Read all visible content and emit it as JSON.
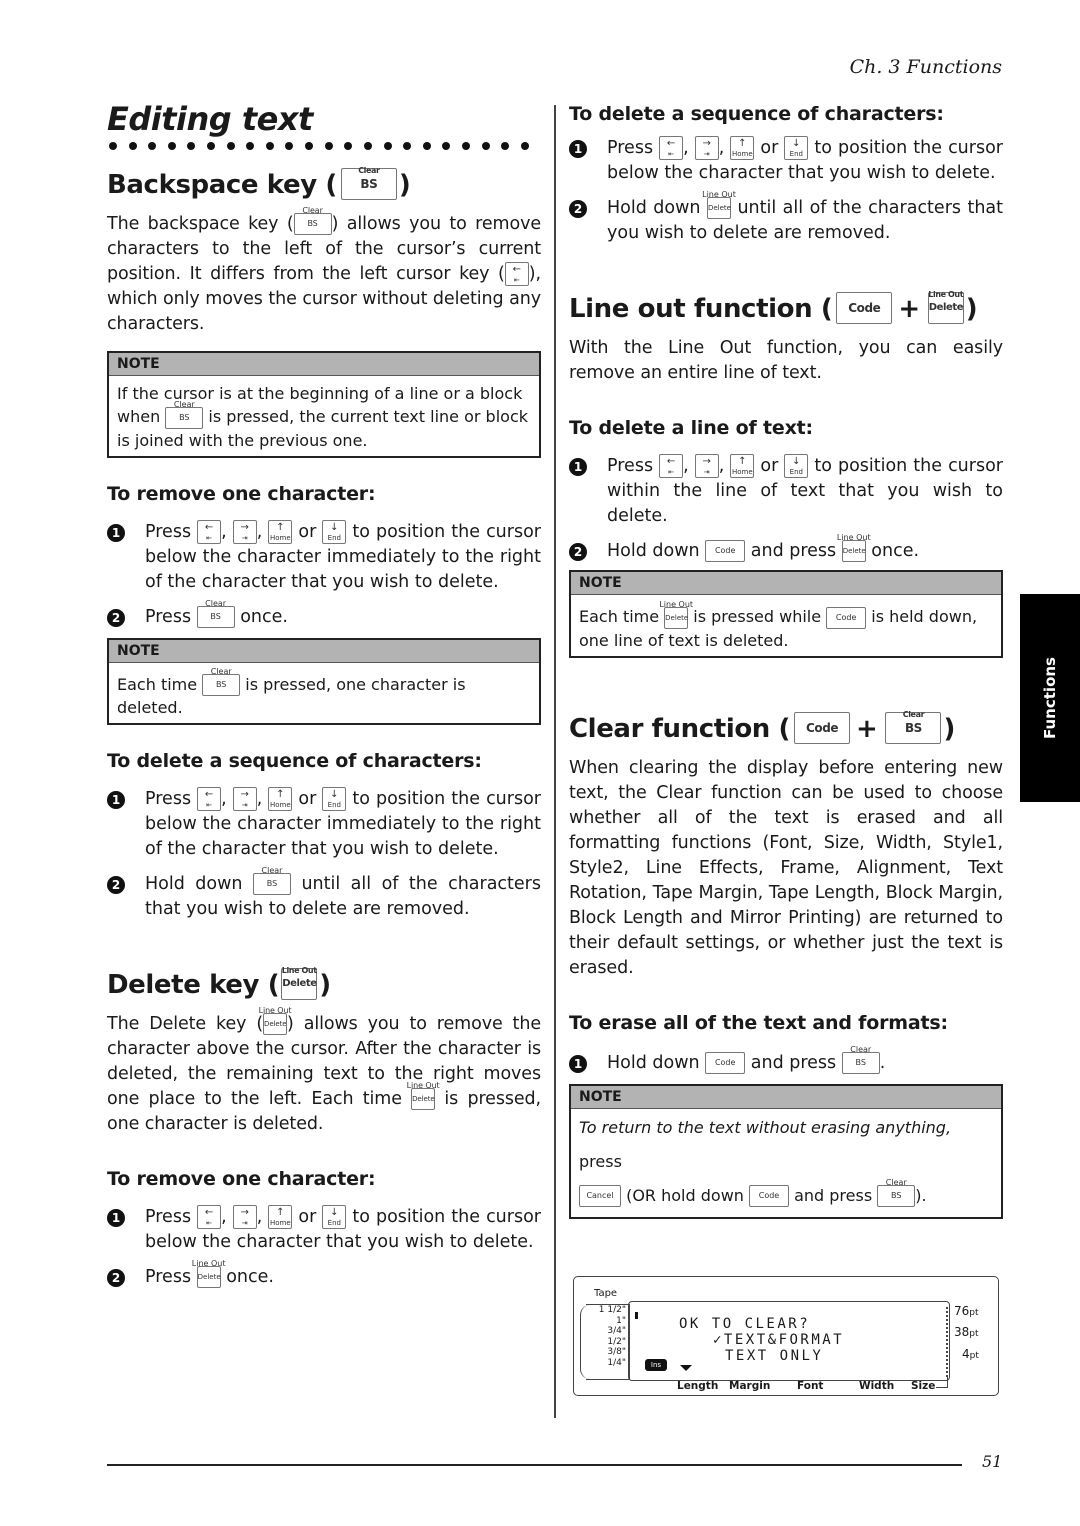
{
  "header": {
    "chapter": "Ch. 3 Functions"
  },
  "side_tab": {
    "label": "Functions"
  },
  "footer": {
    "page_number": "51"
  },
  "keys": {
    "bs": "BS",
    "clear": "Clear",
    "delete": "Delete",
    "line_out": "Line Out",
    "code": "Code",
    "cancel": "Cancel",
    "home": "Home",
    "end": "End",
    "left_arrow": "←",
    "left_bar": "⇤",
    "right_arrow": "→",
    "right_bar": "⇥",
    "up_arrow": "↑",
    "down_arrow": "↓"
  },
  "left": {
    "title": "Editing text",
    "backspace": {
      "heading": "Backspace key (",
      "heading_close": ")",
      "para_a": "The backspace key (",
      "para_b": ") allows you to remove characters to the left of the cursor’s current position. It differs from the left cursor key (",
      "para_c": "), which only moves the cursor without deleting any characters.",
      "note": {
        "header": "NOTE",
        "a": "If the cursor is at the beginning of a line or a block when ",
        "b": " is pressed, the current text line or block is joined with the previous one."
      },
      "remove_one": {
        "heading": "To remove one character:",
        "step1_a": "Press ",
        "comma": ", ",
        "or": " or ",
        "step1_b": " to position the cursor below the character immediately to the right of the character that you wish to delete.",
        "step2_a": "Press ",
        "step2_b": " once.",
        "note_header": "NOTE",
        "note_a": "Each time ",
        "note_b": " is pressed, one character is deleted."
      },
      "delete_seq": {
        "heading": "To delete a sequence of characters:",
        "step1_a": "Press ",
        "step1_b": " to position the cursor below the character immediately to the right of the character that you wish to delete.",
        "step2_a": "Hold down ",
        "step2_b": " until all of the characters that you wish to delete are removed."
      }
    },
    "delete_key": {
      "heading": "Delete key (",
      "heading_close": ")",
      "para_a": "The Delete key (",
      "para_b": ") allows you to remove the character above the cursor. After the character is deleted, the remaining text to the right moves one place to the left. Each time ",
      "para_c": " is pressed, one character is deleted.",
      "remove_one": {
        "heading": "To remove one character:",
        "step1_a": "Press ",
        "step1_b": " to position the cursor below the character that you wish to delete.",
        "step2_a": "Press ",
        "step2_b": " once."
      }
    }
  },
  "right": {
    "delete_seq": {
      "heading": "To delete a sequence of characters:",
      "step1_a": "Press ",
      "step1_b": " to position the cursor below the character that you wish to delete.",
      "step2_a": "Hold down ",
      "step2_b": " until all of the characters that you wish to delete are removed."
    },
    "line_out": {
      "heading": "Line out function (",
      "plus": "+",
      "heading_close": ")",
      "para": "With the Line Out function, you can easily remove an entire line of text.",
      "sub_heading": "To delete a line of text:",
      "step1_a": "Press ",
      "step1_b": " to position the cursor within the line of text that you wish to delete.",
      "step2_a": "Hold down ",
      "step2_b": " and press ",
      "step2_c": " once.",
      "note_header": "NOTE",
      "note_a": "Each time ",
      "note_b": " is pressed while ",
      "note_c": " is held down, one line of text is deleted."
    },
    "clear": {
      "heading": "Clear function (",
      "plus": "+",
      "heading_close": ")",
      "para": "When clearing the display before entering new text, the Clear function can be used to choose whether all of the text is erased and all formatting functions (Font, Size, Width, Style1, Style2, Line Effects, Frame, Alignment, Text Rotation, Tape Margin, Tape Length, Block Margin, Block Length and Mirror Printing) are returned to their default settings, or whether just the text is erased.",
      "sub_heading": "To erase all of the text and formats:",
      "step1_a": "Hold down ",
      "step1_b": " and press ",
      "step1_c": ".",
      "note_header": "NOTE",
      "note_italic": "To return to the text without erasing anything,",
      "note_a": " press",
      "note_b": " (OR hold down ",
      "note_c": " and press ",
      "note_d": ")."
    },
    "lcd": {
      "tape_label": "Tape",
      "tape_sizes": [
        "1 1/2\"",
        "1\"",
        "3/4\"",
        "1/2\"",
        "3/8\"",
        "1/4\""
      ],
      "line1": "OK TO CLEAR?",
      "line2": "✓TEXT&FORMAT",
      "line3": "TEXT ONLY",
      "ins_label": "Ins",
      "size_76": "76",
      "size_38": "38",
      "size_4": "4",
      "pt": "pt",
      "bottom_labels": [
        "Length",
        "Margin",
        "Font",
        "Width",
        "Size"
      ]
    }
  }
}
